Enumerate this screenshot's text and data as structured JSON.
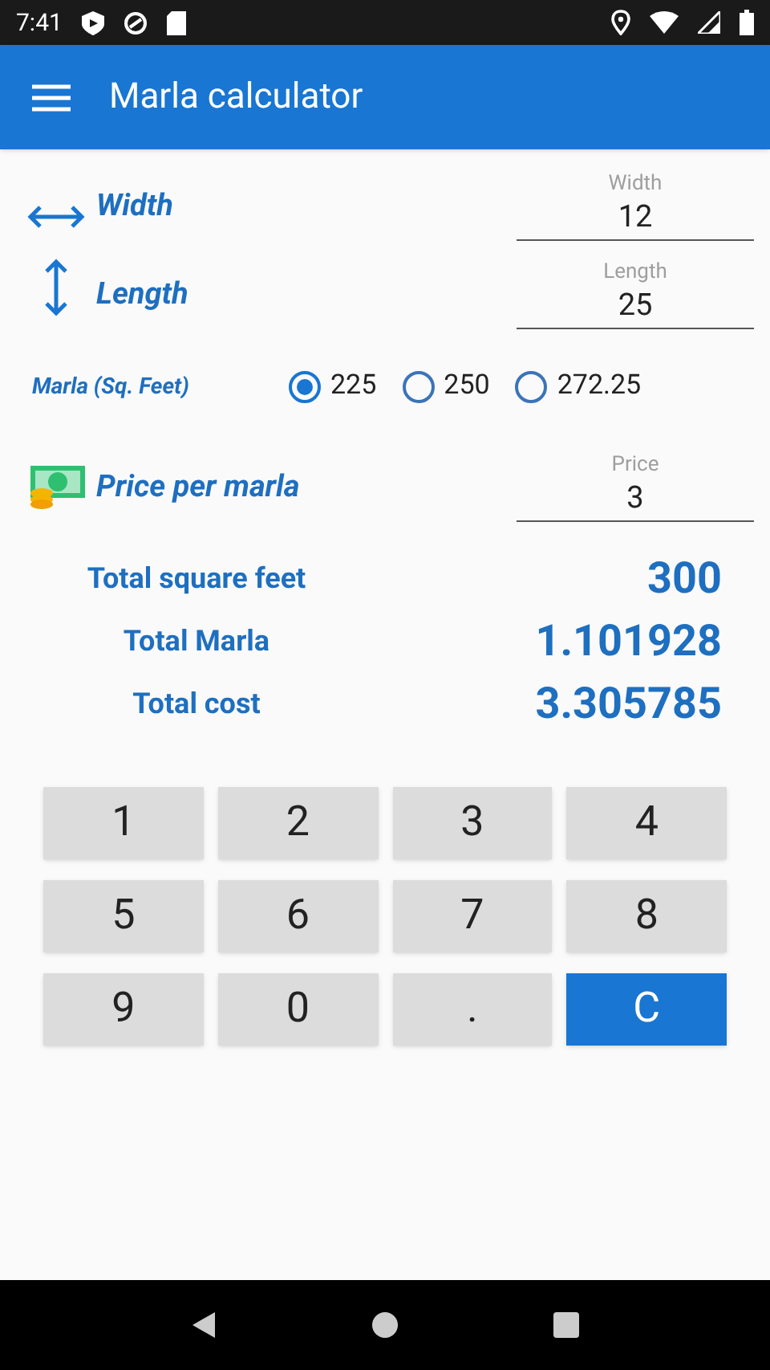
{
  "status_bar": {
    "time": "7:41"
  },
  "app_bar": {
    "title": "Marla calculator"
  },
  "inputs": [
    {
      "kind": "width",
      "label": "Width",
      "field_label": "Width",
      "value": "12"
    },
    {
      "kind": "length",
      "label": "Length",
      "field_label": "Length",
      "value": "25"
    }
  ],
  "marla_size": {
    "label": "Marla (Sq. Feet)",
    "options": [
      {
        "label": "225",
        "selected": true
      },
      {
        "label": "250",
        "selected": false
      },
      {
        "label": "272.25",
        "selected": false
      }
    ]
  },
  "price": {
    "label": "Price per marla",
    "field_label": "Price",
    "value": "3"
  },
  "results": [
    {
      "label": "Total square feet",
      "value": "300"
    },
    {
      "label": "Total Marla",
      "value": "1.101928"
    },
    {
      "label": "Total cost",
      "value": "3.305785"
    }
  ],
  "keypad": [
    {
      "label": "1",
      "kind": "digit"
    },
    {
      "label": "2",
      "kind": "digit"
    },
    {
      "label": "3",
      "kind": "digit"
    },
    {
      "label": "4",
      "kind": "digit"
    },
    {
      "label": "5",
      "kind": "digit"
    },
    {
      "label": "6",
      "kind": "digit"
    },
    {
      "label": "7",
      "kind": "digit"
    },
    {
      "label": "8",
      "kind": "digit"
    },
    {
      "label": "9",
      "kind": "digit"
    },
    {
      "label": "0",
      "kind": "digit"
    },
    {
      "label": ".",
      "kind": "digit"
    },
    {
      "label": "C",
      "kind": "clear"
    }
  ]
}
